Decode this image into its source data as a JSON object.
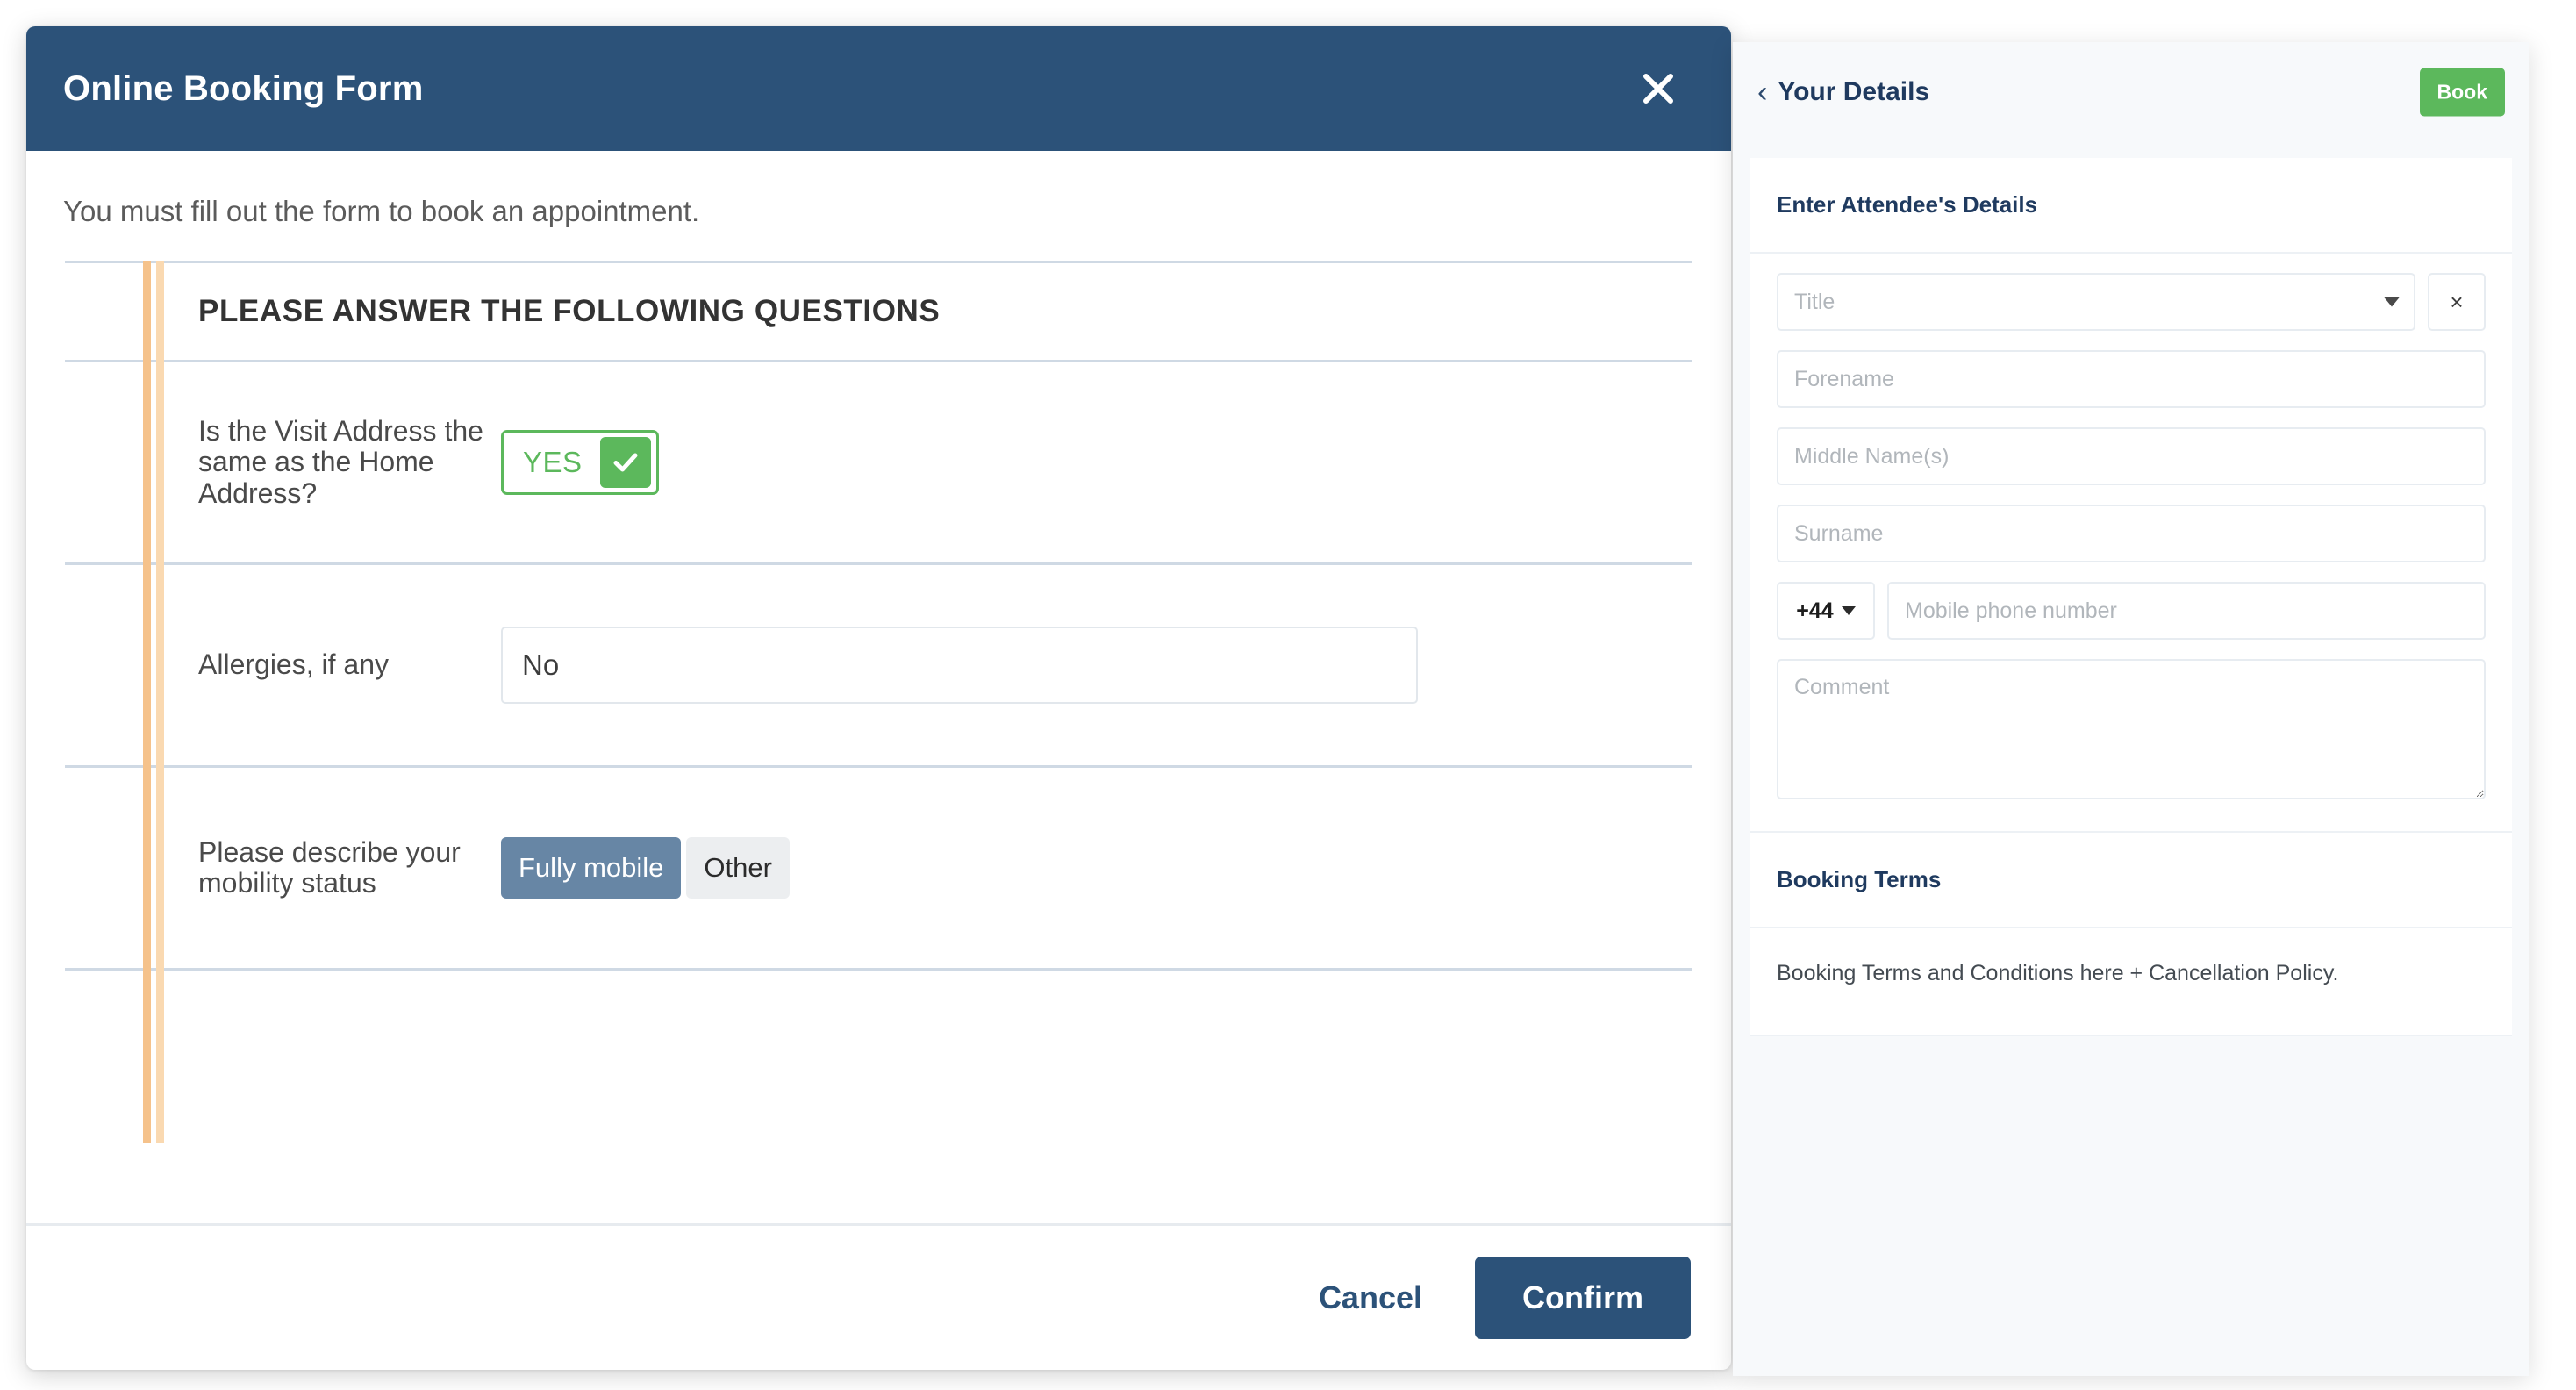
{
  "modal": {
    "title": "Online Booking Form",
    "close_icon": "close-icon",
    "intro": "You must fill out the form to book an appointment.",
    "section_title": "PLEASE ANSWER THE FOLLOWING QUESTIONS",
    "questions": [
      {
        "label": "Is the Visit Address the same as the Home Address?",
        "type": "yes-toggle",
        "value": "YES",
        "checked": true
      },
      {
        "label": "Allergies, if any",
        "type": "text",
        "value": "No",
        "placeholder": ""
      },
      {
        "label": "Please describe your mobility status",
        "type": "segmented",
        "options": [
          "Fully mobile",
          "Other"
        ],
        "selected": "Fully mobile"
      }
    ],
    "footer": {
      "cancel_label": "Cancel",
      "confirm_label": "Confirm"
    },
    "colors": {
      "header_blue": "#2c5279",
      "accent_green": "#5cb85c",
      "segment_active": "#6786a5",
      "guide_orange": "#f5c28b"
    }
  },
  "panel": {
    "back_icon": "chevron-left-icon",
    "title": "Your Details",
    "book_label": "Book",
    "attendee": {
      "heading": "Enter Attendee's Details",
      "title_placeholder": "Title",
      "title_value": "",
      "clear_label": "×",
      "forename_placeholder": "Forename",
      "forename_value": "",
      "middle_placeholder": "Middle Name(s)",
      "middle_value": "",
      "surname_placeholder": "Surname",
      "surname_value": "",
      "dial_code": "+44",
      "mobile_placeholder": "Mobile phone number",
      "mobile_value": "",
      "comment_placeholder": "Comment",
      "comment_value": ""
    },
    "terms": {
      "heading": "Booking Terms",
      "body": "Booking Terms and Conditions here + Cancellation Policy."
    },
    "colors": {
      "book_green": "#5cb85c",
      "heading_navy": "#1f3a5f",
      "panel_bg": "#f7f9fb"
    }
  }
}
